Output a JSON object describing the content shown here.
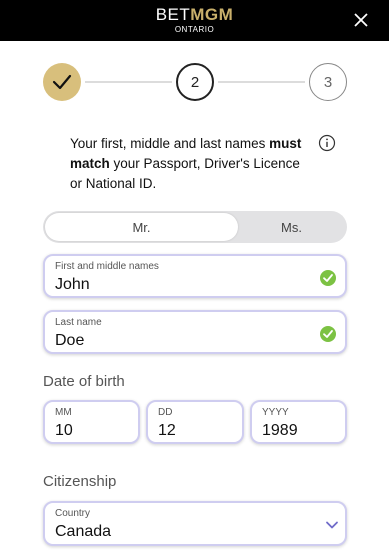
{
  "header": {
    "logo_bet": "BET",
    "logo_mgm": "MGM",
    "logo_sub": "ONTARIO",
    "close_icon": "close-icon"
  },
  "stepper": {
    "step1_icon": "check-icon",
    "step2": "2",
    "step3": "3"
  },
  "notice": {
    "text_1": "Your first, middle and last names ",
    "bold_1": "must match",
    "text_2": " your Passport, Driver's Licence or National ID.",
    "info_icon": "info-icon"
  },
  "title_toggle": {
    "mr": "Mr.",
    "ms": "Ms.",
    "selected": "Mr."
  },
  "first_name": {
    "label": "First and middle names",
    "value": "John",
    "valid": true
  },
  "last_name": {
    "label": "Last name",
    "value": "Doe",
    "valid": true
  },
  "dob": {
    "title": "Date of birth",
    "mm_label": "MM",
    "mm_value": "10",
    "dd_label": "DD",
    "dd_value": "12",
    "yyyy_label": "YYYY",
    "yyyy_value": "1989"
  },
  "citizenship": {
    "title": "Citizenship",
    "label": "Country",
    "value": "Canada"
  },
  "colors": {
    "header_bg": "#000000",
    "brand_gold": "#c9b06b",
    "step_done": "#d8bf7c",
    "field_border": "#cfcdf0",
    "valid_green": "#7cc243"
  }
}
